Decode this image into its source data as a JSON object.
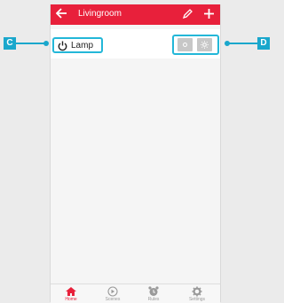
{
  "header": {
    "title": "Livingroom",
    "back_icon": "back-arrow-icon",
    "edit_icon": "pencil-icon",
    "add_icon": "plus-icon",
    "color": "#e8203b"
  },
  "device": {
    "name": "Lamp",
    "power_icon": "power-icon",
    "controls": [
      {
        "name": "off-button",
        "icon": "sun-dim-icon"
      },
      {
        "name": "on-button",
        "icon": "sun-icon"
      }
    ]
  },
  "callouts": {
    "left": "C",
    "right": "D",
    "color": "#1aa7cc"
  },
  "tabbar": {
    "tabs": [
      {
        "label": "Home",
        "icon": "home-icon",
        "active": true
      },
      {
        "label": "Scenes",
        "icon": "play-circle-icon",
        "active": false
      },
      {
        "label": "Rules",
        "icon": "alarm-clock-icon",
        "active": false
      },
      {
        "label": "Settings",
        "icon": "gear-icon",
        "active": false
      }
    ]
  }
}
